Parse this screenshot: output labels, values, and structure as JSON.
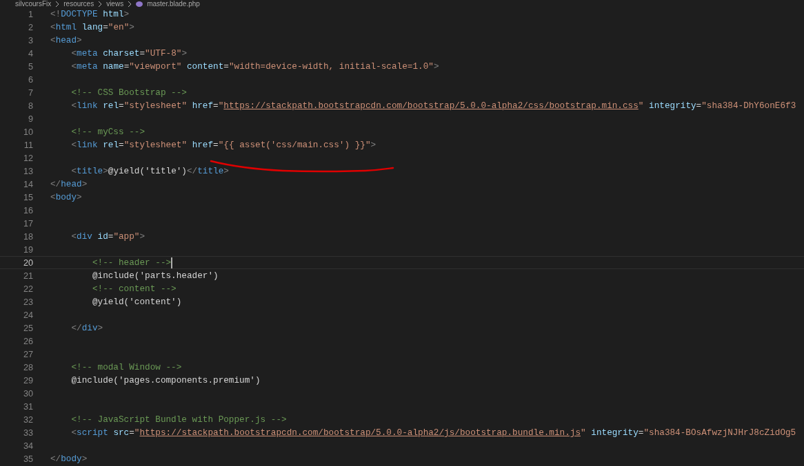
{
  "breadcrumb": [
    "silvcoursFix",
    "resources",
    "views",
    "master.blade.php"
  ],
  "lines": [
    {
      "number": "1",
      "current": false,
      "tokens": [
        {
          "kind": "punct",
          "text": "<!"
        },
        {
          "kind": "tag",
          "text": "DOCTYPE"
        },
        {
          "kind": "attr",
          "text": " html"
        },
        {
          "kind": "punct",
          "text": ">"
        }
      ]
    },
    {
      "number": "2",
      "current": false,
      "tokens": [
        {
          "kind": "punct",
          "text": "<"
        },
        {
          "kind": "tag",
          "text": "html"
        },
        {
          "kind": "attr",
          "text": " lang"
        },
        {
          "kind": "text",
          "text": "="
        },
        {
          "kind": "string",
          "text": "\"en\""
        },
        {
          "kind": "punct",
          "text": ">"
        }
      ]
    },
    {
      "number": "3",
      "current": false,
      "tokens": [
        {
          "kind": "punct",
          "text": "<"
        },
        {
          "kind": "tag",
          "text": "head"
        },
        {
          "kind": "punct",
          "text": ">"
        }
      ]
    },
    {
      "number": "4",
      "current": false,
      "tokens": [
        {
          "kind": "punct",
          "text": "    <"
        },
        {
          "kind": "tag",
          "text": "meta"
        },
        {
          "kind": "attr",
          "text": " charset"
        },
        {
          "kind": "text",
          "text": "="
        },
        {
          "kind": "string",
          "text": "\"UTF-8\""
        },
        {
          "kind": "punct",
          "text": ">"
        }
      ]
    },
    {
      "number": "5",
      "current": false,
      "tokens": [
        {
          "kind": "punct",
          "text": "    <"
        },
        {
          "kind": "tag",
          "text": "meta"
        },
        {
          "kind": "attr",
          "text": " name"
        },
        {
          "kind": "text",
          "text": "="
        },
        {
          "kind": "string",
          "text": "\"viewport\""
        },
        {
          "kind": "attr",
          "text": " content"
        },
        {
          "kind": "text",
          "text": "="
        },
        {
          "kind": "string",
          "text": "\"width=device-width, initial-scale=1.0\""
        },
        {
          "kind": "punct",
          "text": ">"
        }
      ]
    },
    {
      "number": "6",
      "current": false
    },
    {
      "number": "7",
      "current": false,
      "tokens": [
        {
          "kind": "comment",
          "text": "    <!-- CSS Bootstrap -->"
        }
      ]
    },
    {
      "number": "8",
      "current": false,
      "tokens": [
        {
          "kind": "punct",
          "text": "    <"
        },
        {
          "kind": "tag",
          "text": "link"
        },
        {
          "kind": "attr",
          "text": " rel"
        },
        {
          "kind": "text",
          "text": "="
        },
        {
          "kind": "string",
          "text": "\"stylesheet\""
        },
        {
          "kind": "attr",
          "text": " href"
        },
        {
          "kind": "text",
          "text": "="
        },
        {
          "kind": "string",
          "text": "\""
        },
        {
          "kind": "link",
          "text": "https://stackpath.bootstrapcdn.com/bootstrap/5.0.0-alpha2/css/bootstrap.min.css"
        },
        {
          "kind": "string",
          "text": "\""
        },
        {
          "kind": "attr",
          "text": " integrity"
        },
        {
          "kind": "text",
          "text": "="
        },
        {
          "kind": "string",
          "text": "\"sha384-DhY6onE6f3"
        }
      ]
    },
    {
      "number": "9",
      "current": false
    },
    {
      "number": "10",
      "current": false,
      "tokens": [
        {
          "kind": "comment",
          "text": "    <!-- myCss -->"
        }
      ]
    },
    {
      "number": "11",
      "current": false,
      "tokens": [
        {
          "kind": "punct",
          "text": "    <"
        },
        {
          "kind": "tag",
          "text": "link"
        },
        {
          "kind": "attr",
          "text": " rel"
        },
        {
          "kind": "text",
          "text": "="
        },
        {
          "kind": "string",
          "text": "\"stylesheet\""
        },
        {
          "kind": "attr",
          "text": " href"
        },
        {
          "kind": "text",
          "text": "="
        },
        {
          "kind": "string",
          "text": "\"{{ asset('css/main.css') }}\""
        },
        {
          "kind": "punct",
          "text": ">"
        }
      ]
    },
    {
      "number": "12",
      "current": false
    },
    {
      "number": "13",
      "current": false,
      "tokens": [
        {
          "kind": "punct",
          "text": "    <"
        },
        {
          "kind": "tag",
          "text": "title"
        },
        {
          "kind": "punct",
          "text": ">"
        },
        {
          "kind": "text",
          "text": "@yield('title')"
        },
        {
          "kind": "punct",
          "text": "</"
        },
        {
          "kind": "tag",
          "text": "title"
        },
        {
          "kind": "punct",
          "text": ">"
        }
      ]
    },
    {
      "number": "14",
      "current": false,
      "tokens": [
        {
          "kind": "punct",
          "text": "</"
        },
        {
          "kind": "tag",
          "text": "head"
        },
        {
          "kind": "punct",
          "text": ">"
        }
      ]
    },
    {
      "number": "15",
      "current": false,
      "tokens": [
        {
          "kind": "punct",
          "text": "<"
        },
        {
          "kind": "tag",
          "text": "body"
        },
        {
          "kind": "punct",
          "text": ">"
        }
      ]
    },
    {
      "number": "16",
      "current": false
    },
    {
      "number": "17",
      "current": false
    },
    {
      "number": "18",
      "current": false,
      "tokens": [
        {
          "kind": "punct",
          "text": "    <"
        },
        {
          "kind": "tag",
          "text": "div"
        },
        {
          "kind": "attr",
          "text": " id"
        },
        {
          "kind": "text",
          "text": "="
        },
        {
          "kind": "string",
          "text": "\"app\""
        },
        {
          "kind": "punct",
          "text": ">"
        }
      ]
    },
    {
      "number": "19",
      "current": false
    },
    {
      "number": "20",
      "current": true,
      "tokens": [
        {
          "kind": "comment",
          "text": "        <!-- header -->"
        }
      ]
    },
    {
      "number": "21",
      "current": false,
      "tokens": [
        {
          "kind": "text",
          "text": "        @include('parts.header')"
        }
      ]
    },
    {
      "number": "22",
      "current": false,
      "tokens": [
        {
          "kind": "comment",
          "text": "        <!-- content -->"
        }
      ]
    },
    {
      "number": "23",
      "current": false,
      "tokens": [
        {
          "kind": "text",
          "text": "        @yield('content')"
        }
      ]
    },
    {
      "number": "24",
      "current": false
    },
    {
      "number": "25",
      "current": false,
      "tokens": [
        {
          "kind": "punct",
          "text": "    </"
        },
        {
          "kind": "tag",
          "text": "div"
        },
        {
          "kind": "punct",
          "text": ">"
        }
      ]
    },
    {
      "number": "26",
      "current": false
    },
    {
      "number": "27",
      "current": false
    },
    {
      "number": "28",
      "current": false,
      "tokens": [
        {
          "kind": "comment",
          "text": "    <!-- modal Window -->"
        }
      ]
    },
    {
      "number": "29",
      "current": false,
      "tokens": [
        {
          "kind": "text",
          "text": "    @include('pages.components.premium')"
        }
      ]
    },
    {
      "number": "30",
      "current": false
    },
    {
      "number": "31",
      "current": false
    },
    {
      "number": "32",
      "current": false,
      "tokens": [
        {
          "kind": "comment",
          "text": "    <!-- JavaScript Bundle with Popper.js -->"
        }
      ]
    },
    {
      "number": "33",
      "current": false,
      "tokens": [
        {
          "kind": "punct",
          "text": "    <"
        },
        {
          "kind": "tag",
          "text": "script"
        },
        {
          "kind": "attr",
          "text": " src"
        },
        {
          "kind": "text",
          "text": "="
        },
        {
          "kind": "string",
          "text": "\""
        },
        {
          "kind": "link",
          "text": "https://stackpath.bootstrapcdn.com/bootstrap/5.0.0-alpha2/js/bootstrap.bundle.min.js"
        },
        {
          "kind": "string",
          "text": "\""
        },
        {
          "kind": "attr",
          "text": " integrity"
        },
        {
          "kind": "text",
          "text": "="
        },
        {
          "kind": "string",
          "text": "\"sha384-BOsAfwzjNJHrJ8cZidOg5"
        }
      ]
    },
    {
      "number": "34",
      "current": false
    },
    {
      "number": "35",
      "current": false,
      "tokens": [
        {
          "kind": "punct",
          "text": "</"
        },
        {
          "kind": "tag",
          "text": "body"
        },
        {
          "kind": "punct",
          "text": ">"
        }
      ]
    }
  ]
}
